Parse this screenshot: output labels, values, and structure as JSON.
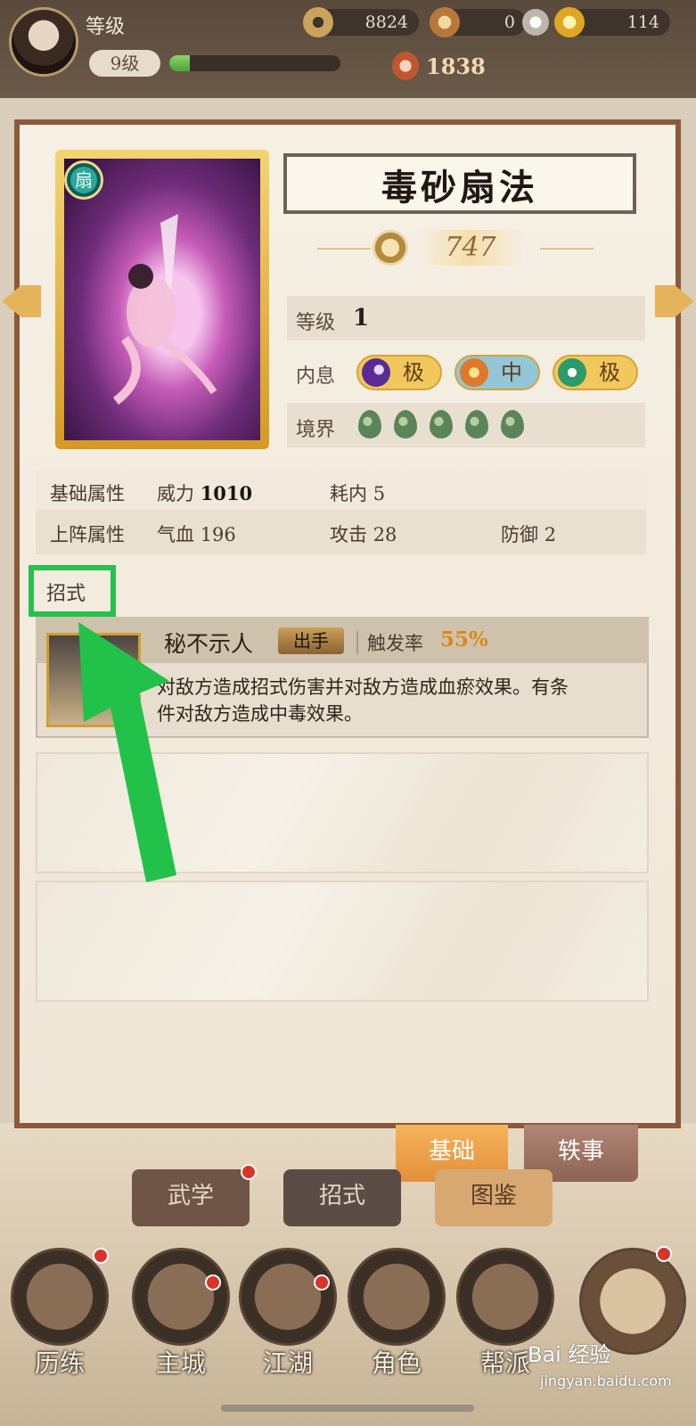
{
  "header": {
    "level_title": "等级",
    "level_value": "9级",
    "exp_progress": 0.12,
    "copper": "8824",
    "jade": "0",
    "gold": "114",
    "power": "1838"
  },
  "skill_card": {
    "name": "毒砂扇法",
    "power": "747",
    "level_label": "等级",
    "level_value": "1",
    "inner_label": "内息",
    "inner_values": [
      "极",
      "中",
      "极"
    ],
    "realm_label": "境界"
  },
  "attributes": {
    "base_label": "基础属性",
    "might_label": "威力",
    "might_value": "1010",
    "cost_label": "耗内",
    "cost_value": "5",
    "deploy_label": "上阵属性",
    "hp_label": "气血",
    "hp_value": "196",
    "atk_label": "攻击",
    "atk_value": "28",
    "def_label": "防御",
    "def_value": "2"
  },
  "moves": {
    "section_label": "招式",
    "items": [
      {
        "name": "秘不示人",
        "tag": "出手",
        "rate_label": "触发率",
        "rate": "55%",
        "description": "对敌方造成招式伤害并对敌方造成血瘀效果。有条件对敌方造成中毒效果。"
      }
    ]
  },
  "panel_tabs": [
    "基础",
    "轶事"
  ],
  "lower_tabs": [
    "武学",
    "招式",
    "图鉴"
  ],
  "nav": [
    "历练",
    "主城",
    "江湖",
    "角色",
    "帮派"
  ],
  "watermark": {
    "main": "Bai 经验",
    "sub": "jingyan.baidu.com"
  },
  "colors": {
    "highlight": "#26c24c",
    "gold": "#e5b45a",
    "rate": "#d88a18"
  }
}
